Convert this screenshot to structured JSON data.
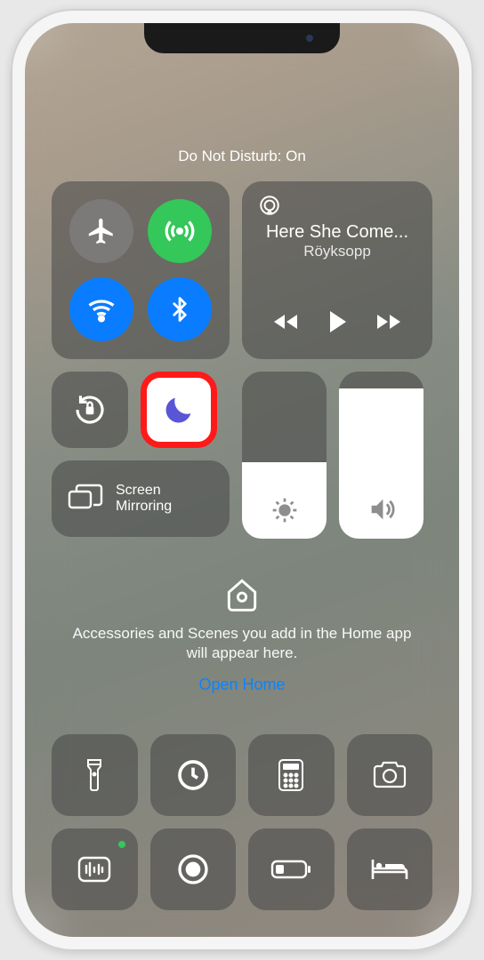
{
  "status": {
    "dnd": "Do Not Disturb: On"
  },
  "nowplaying": {
    "title": "Here She Come...",
    "artist": "Röyksopp"
  },
  "screenmirror": {
    "label": "Screen\nMirroring"
  },
  "home": {
    "text": "Accessories and Scenes you add in the Home app will appear here.",
    "link": "Open Home"
  },
  "sliders": {
    "brightness_pct": 46,
    "volume_pct": 90
  },
  "connectivity": {
    "airplane": false,
    "cellular": true,
    "wifi": true,
    "bluetooth": true
  }
}
